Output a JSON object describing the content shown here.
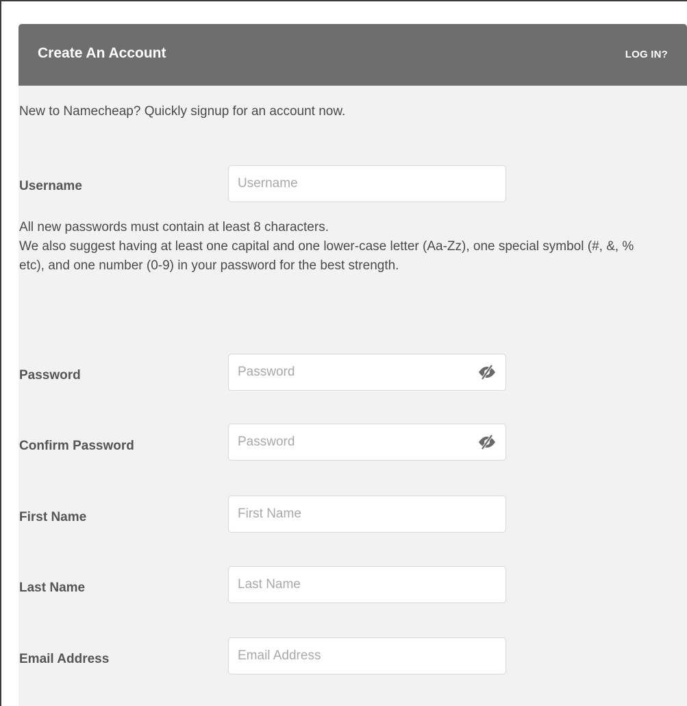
{
  "header": {
    "title": "Create An Account",
    "login_link": "LOG IN?"
  },
  "intro_text": "New to Namecheap? Quickly signup for an account now.",
  "password_hint": {
    "line1": "All new passwords must contain at least 8 characters.",
    "line2": "We also suggest having at least one capital and one lower-case letter (Aa-Zz), one special symbol (#, &, % etc), and one number (0-9) in your password for the best strength."
  },
  "fields": {
    "username": {
      "label": "Username",
      "placeholder": "Username",
      "value": ""
    },
    "password": {
      "label": "Password",
      "placeholder": "Password",
      "value": "",
      "icon": "eye-off-icon"
    },
    "confirm_password": {
      "label": "Confirm Password",
      "placeholder": "Password",
      "value": "",
      "icon": "eye-off-icon"
    },
    "first_name": {
      "label": "First Name",
      "placeholder": "First Name",
      "value": ""
    },
    "last_name": {
      "label": "Last Name",
      "placeholder": "Last Name",
      "value": ""
    },
    "email": {
      "label": "Email Address",
      "placeholder": "Email Address",
      "value": ""
    }
  },
  "colors": {
    "header_bg": "#6e6e6e",
    "card_bg": "#f2f2f2",
    "label_text": "#555555",
    "body_text": "#4a4a4a",
    "placeholder": "#a9a9a9"
  }
}
